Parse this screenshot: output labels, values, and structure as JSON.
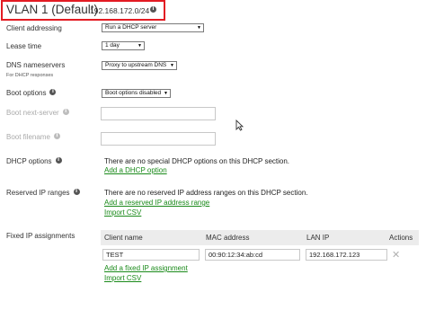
{
  "header": {
    "vlan_title": "VLAN 1 (Default)",
    "subnet": "192.168.172.0/24",
    "info_symbol": "i"
  },
  "fields": {
    "client_addressing": {
      "label": "Client addressing",
      "value": "Run a DHCP server"
    },
    "lease_time": {
      "label": "Lease time",
      "value": "1 day"
    },
    "dns": {
      "label": "DNS nameservers",
      "sublabel": "For DHCP responses",
      "value": "Proxy to upstream DNS"
    },
    "boot_options": {
      "label": "Boot options",
      "value": "Boot options disabled"
    },
    "boot_next_server": {
      "label": "Boot next-server",
      "value": ""
    },
    "boot_filename": {
      "label": "Boot filename",
      "value": ""
    }
  },
  "dhcp_options": {
    "label": "DHCP options",
    "note": "There are no special DHCP options on this DHCP section.",
    "add_link": "Add a DHCP option"
  },
  "reserved_ranges": {
    "label": "Reserved IP ranges",
    "note": "There are no reserved IP address ranges on this DHCP section.",
    "add_link": "Add a reserved IP address range",
    "import_link": "Import CSV"
  },
  "fixed_assignments": {
    "label": "Fixed IP assignments",
    "columns": [
      "Client name",
      "MAC address",
      "LAN IP",
      "Actions"
    ],
    "rows": [
      {
        "client_name": "TEST",
        "mac": "00:90:12:34:ab:cd",
        "lan_ip": "192.168.172.123",
        "action": "✕"
      }
    ],
    "add_link": "Add a fixed IP assignment",
    "import_link": "Import CSV"
  },
  "icons": {
    "info": "info-icon",
    "dropdown": "chevron-down-icon",
    "remove": "close-icon",
    "cursor": "mouse-pointer-icon"
  },
  "colors": {
    "highlight_border": "#e31b23",
    "link": "#1a8a1a",
    "info_icon": "#555555",
    "info_icon_disabled": "#bdbdbd"
  }
}
